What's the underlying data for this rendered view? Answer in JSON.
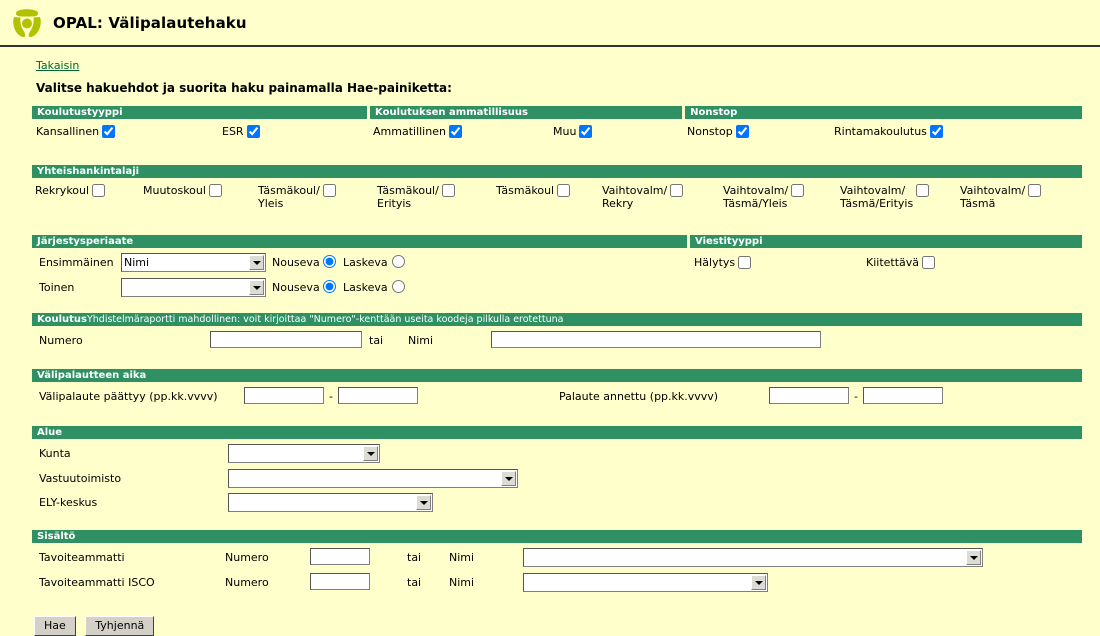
{
  "header": {
    "title": "OPAL: Välipalautehaku",
    "logo_icon": "opal-logo-icon"
  },
  "nav": {
    "back_link": "Takaisin"
  },
  "instruction": "Valitse hakuehdot ja suorita haku painamalla Hae-painiketta:",
  "colors": {
    "page_background": "#ffffcc",
    "section_header": "#2e9063",
    "section_header_text": "#ffffff",
    "link": "#006633",
    "logo": "#b5c400"
  },
  "sections": {
    "koulutustyyppi": {
      "title": "Koulutustyyppi",
      "checkboxes": [
        {
          "label": "Kansallinen",
          "checked": true
        },
        {
          "label": "ESR",
          "checked": true
        }
      ]
    },
    "ammatillisuus": {
      "title": "Koulutuksen ammatillisuus",
      "checkboxes": [
        {
          "label": "Ammatillinen",
          "checked": true
        },
        {
          "label": "Muu",
          "checked": true
        }
      ]
    },
    "nonstop": {
      "title": "Nonstop",
      "checkboxes": [
        {
          "label": "Nonstop",
          "checked": true
        },
        {
          "label": "Rintamakoulutus",
          "checked": true
        }
      ]
    },
    "yhteishankintalaji": {
      "title": "Yhteishankintalaji",
      "checkboxes": [
        {
          "label": "Rekrykoul",
          "checked": false
        },
        {
          "label": "Muutoskoul",
          "checked": false
        },
        {
          "label": "Täsmäkoul/\nYleis",
          "checked": false
        },
        {
          "label": "Täsmäkoul/\nErityis",
          "checked": false
        },
        {
          "label": "Täsmäkoul",
          "checked": false
        },
        {
          "label": "Vaihtovalm/\nRekry",
          "checked": false
        },
        {
          "label": "Vaihtovalm/\nTäsmä/Yleis",
          "checked": false
        },
        {
          "label": "Vaihtovalm/\nTäsmä/Erityis",
          "checked": false
        },
        {
          "label": "Vaihtovalm/\nTäsmä",
          "checked": false
        }
      ]
    },
    "jarjestysperiaate": {
      "title": "Järjestysperiaate",
      "rows": [
        {
          "label": "Ensimmäinen",
          "select_value": "Nimi",
          "asc_label": "Nouseva",
          "desc_label": "Laskeva",
          "order": "asc"
        },
        {
          "label": "Toinen",
          "select_value": "",
          "asc_label": "Nouseva",
          "desc_label": "Laskeva",
          "order": "asc"
        }
      ]
    },
    "viestityyppi": {
      "title": "Viestityyppi",
      "checkboxes": [
        {
          "label": "Hälytys",
          "checked": false
        },
        {
          "label": "Kiitettävä",
          "checked": false
        }
      ]
    },
    "koulutus": {
      "title": "Koulutus",
      "title_note": "Yhdistelmäraportti mahdollinen: voit kirjoittaa \"Numero\"-kenttään useita koodeja pilkulla erotettuna",
      "numero_label": "Numero",
      "numero_value": "",
      "tai_label": "tai",
      "nimi_label": "Nimi",
      "nimi_value": ""
    },
    "valipalautteen_aika": {
      "title": "Välipalautteen aika",
      "paattyy_label": "Välipalaute päättyy (pp.kk.vvvv)",
      "paattyy_from": "",
      "paattyy_to": "",
      "separator": "-",
      "annettu_label": "Palaute annettu (pp.kk.vvvv)",
      "annettu_from": "",
      "annettu_to": ""
    },
    "alue": {
      "title": "Alue",
      "rows": [
        {
          "label": "Kunta",
          "value": ""
        },
        {
          "label": "Vastuutoimisto",
          "value": ""
        },
        {
          "label": "ELY-keskus",
          "value": ""
        }
      ]
    },
    "sisalto": {
      "title": "Sisältö",
      "rows": [
        {
          "label": "Tavoiteammatti",
          "numero_label": "Numero",
          "numero_value": "",
          "tai_label": "tai",
          "nimi_label": "Nimi",
          "nimi_value": ""
        },
        {
          "label": "Tavoiteammatti ISCO",
          "numero_label": "Numero",
          "numero_value": "",
          "tai_label": "tai",
          "nimi_label": "Nimi",
          "nimi_value": ""
        }
      ]
    }
  },
  "buttons": {
    "search": "Hae",
    "clear": "Tyhjennä"
  }
}
